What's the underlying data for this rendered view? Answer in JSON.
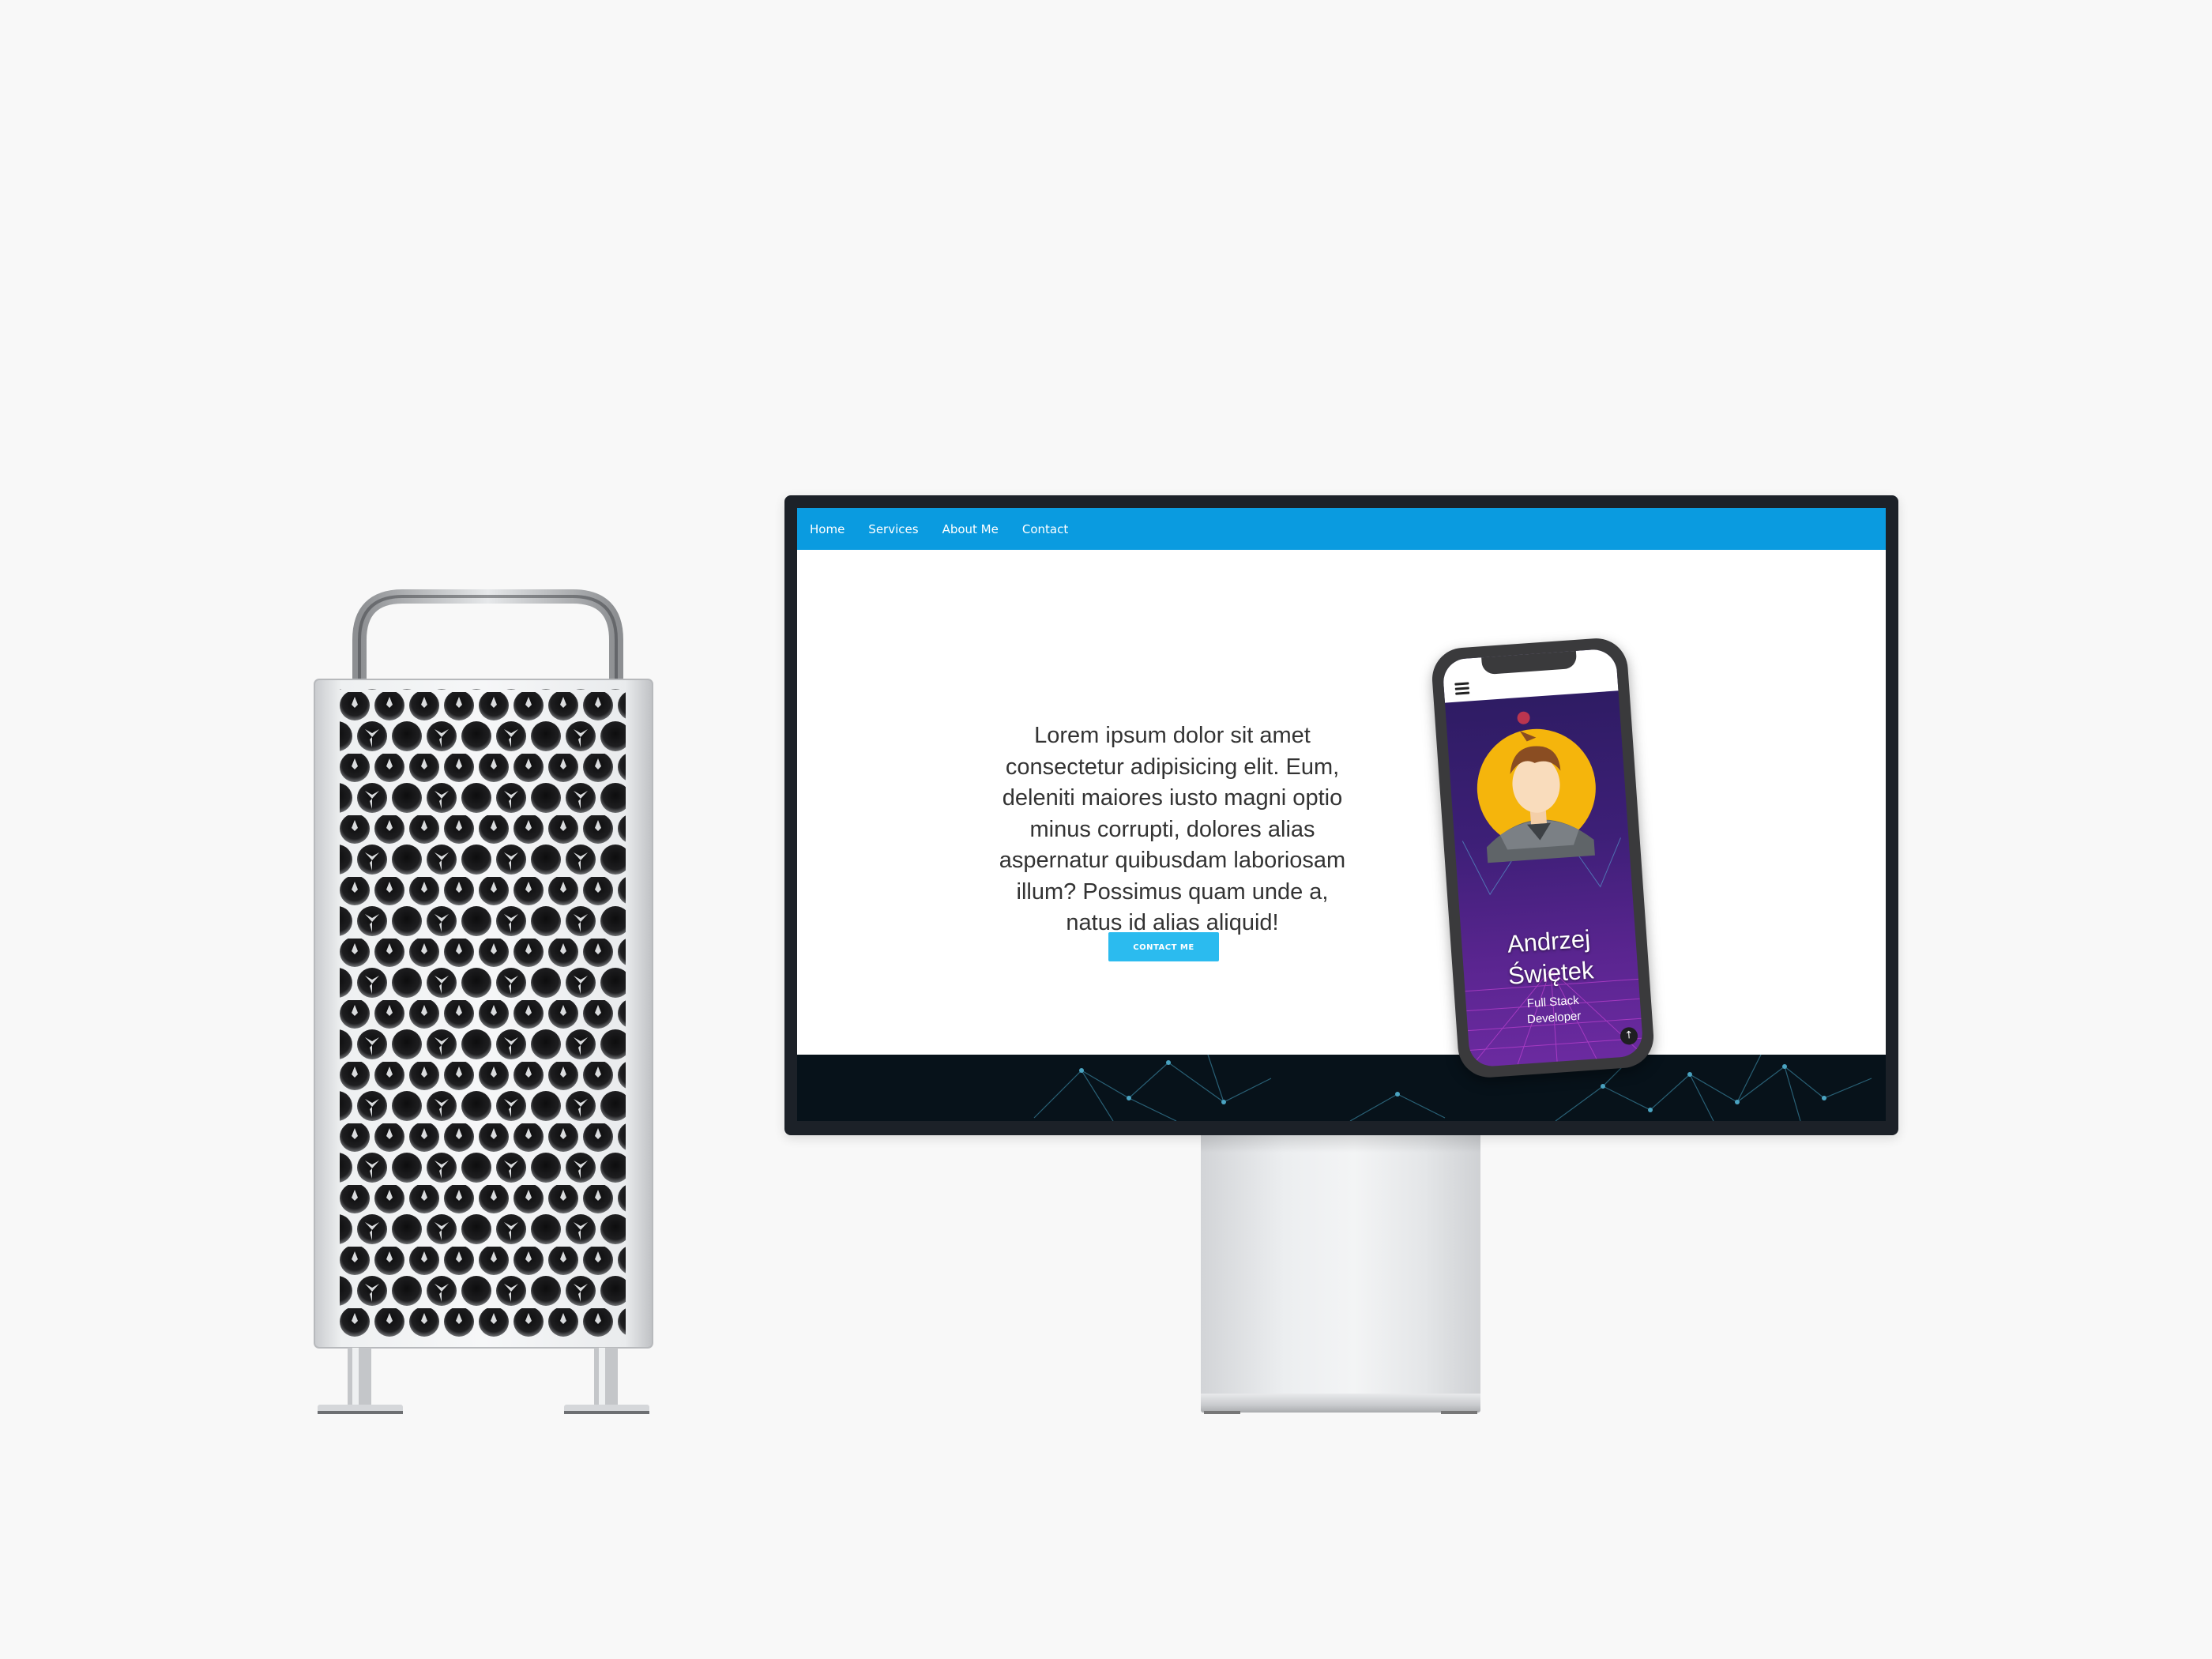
{
  "website": {
    "nav": {
      "items": [
        {
          "label": "Home"
        },
        {
          "label": "Services"
        },
        {
          "label": "About Me"
        },
        {
          "label": "Contact"
        }
      ],
      "color": "#0a9be0"
    },
    "hero": {
      "text": "Lorem ipsum dolor sit amet consectetur adipisicing elit. Eum, deleniti maiores iusto magni optio minus corrupti, dolores alias aspernatur quibusdam laboriosam illum? Possimus quam unde a, natus id alias aliquid!",
      "cta_label": "CONTACT ME",
      "cta_color": "#2bbbef"
    },
    "phone_preview": {
      "first_name": "Andrzej",
      "last_name": "Świętek",
      "role_line1": "Full Stack",
      "role_line2": "Developer",
      "menu_icon": "hamburger-icon",
      "scroll_top_icon": "arrow-up-icon"
    }
  },
  "devices": {
    "tower": "mac-pro-tower",
    "display": "pro-display-monitor"
  }
}
